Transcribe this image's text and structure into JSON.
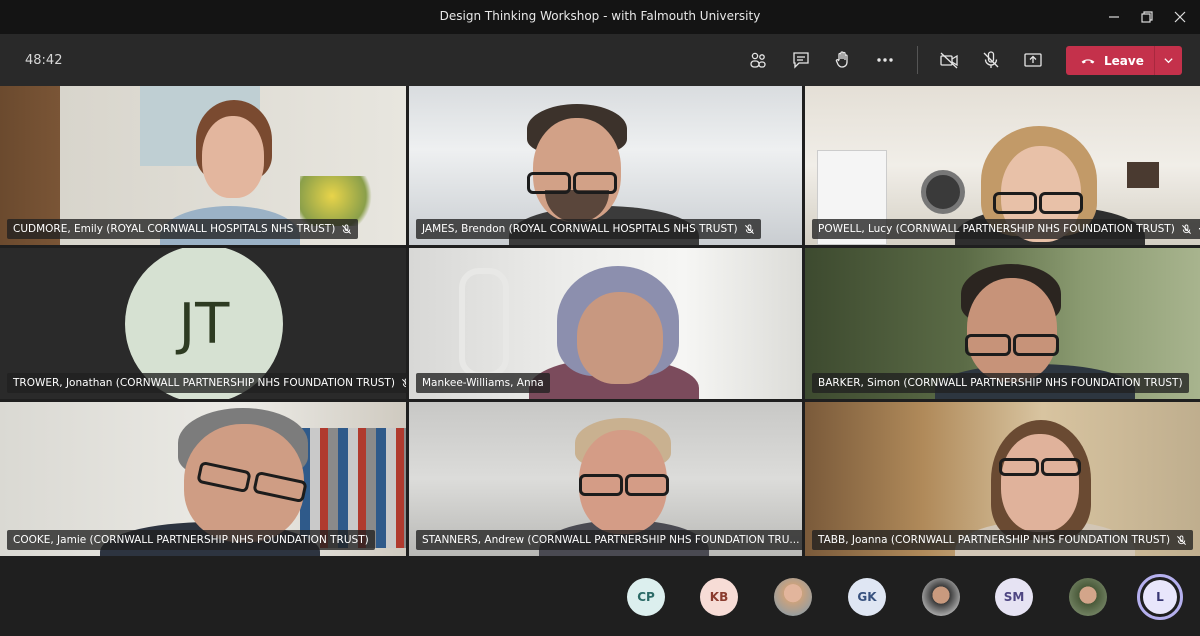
{
  "window": {
    "title": "Design Thinking Workshop - with Falmouth University"
  },
  "toolbar": {
    "timer": "48:42",
    "leave_label": "Leave"
  },
  "participants": [
    {
      "name": "CUDMORE, Emily (ROYAL CORNWALL HOSPITALS NHS TRUST)",
      "muted": true
    },
    {
      "name": "JAMES, Brendon (ROYAL CORNWALL HOSPITALS NHS TRUST)",
      "muted": true
    },
    {
      "name": "POWELL, Lucy (CORNWALL PARTNERSHIP NHS FOUNDATION TRUST)",
      "muted": true,
      "more": "⋯"
    },
    {
      "name": "TROWER, Jonathan (CORNWALL PARTNERSHIP NHS FOUNDATION TRUST)",
      "muted": true,
      "initials": "JT"
    },
    {
      "name": "Mankee-Williams, Anna",
      "muted": false
    },
    {
      "name": "BARKER, Simon (CORNWALL PARTNERSHIP NHS FOUNDATION TRUST)",
      "muted": false
    },
    {
      "name": "COOKE, Jamie (CORNWALL PARTNERSHIP NHS FOUNDATION TRUST)",
      "muted": false
    },
    {
      "name": "STANNERS, Andrew (CORNWALL PARTNERSHIP NHS FOUNDATION TRU...",
      "muted": true
    },
    {
      "name": "TABB, Joanna (CORNWALL PARTNERSHIP NHS FOUNDATION TRUST)",
      "muted": true
    }
  ],
  "roster": [
    {
      "initials": "CP",
      "bg": "#dcefee",
      "fg": "#2b6a66"
    },
    {
      "initials": "KB",
      "bg": "#f7dcd6",
      "fg": "#8a3b2e"
    },
    {
      "photo": true
    },
    {
      "initials": "GK",
      "bg": "#dfe6f3",
      "fg": "#37517e"
    },
    {
      "photo": true
    },
    {
      "initials": "SM",
      "bg": "#e6e3f3",
      "fg": "#4e4682"
    },
    {
      "photo": true
    },
    {
      "initials": "L",
      "bg": "#e8e6fb",
      "fg": "#383773",
      "active": true
    }
  ],
  "colors": {
    "leave": "#c4314b",
    "toolbar": "#292929",
    "titlebar": "#141414",
    "active_ring": "#b5b0ee"
  }
}
